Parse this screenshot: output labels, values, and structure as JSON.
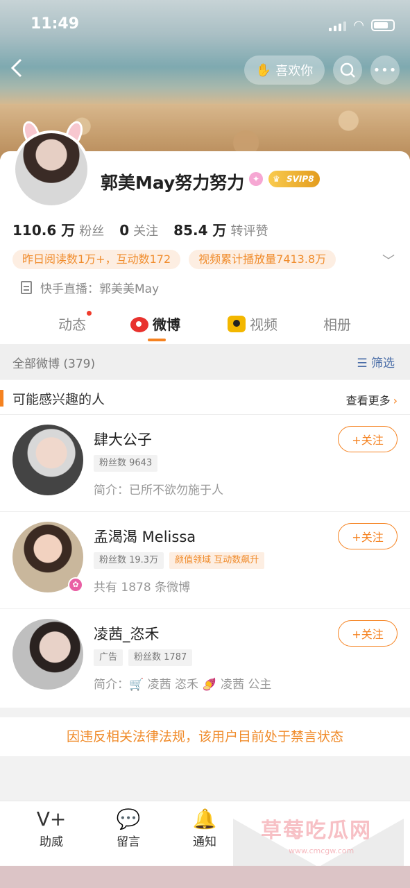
{
  "status": {
    "time": "11:49"
  },
  "header": {
    "likes_label": "喜欢你"
  },
  "profile": {
    "name": "郭美May努力努力",
    "vip_badge": "SVIP8",
    "followers_value": "110.6 万",
    "followers_label": "粉丝",
    "following_value": "0",
    "following_label": "关注",
    "interactions_value": "85.4 万",
    "interactions_label": "转评赞",
    "chips": [
      "昨日阅读数1万+，互动数172",
      "视频累计播放量7413.8万"
    ],
    "live_text": "快手直播：郭美美May"
  },
  "tabs": [
    {
      "label": "动态"
    },
    {
      "label": "微博"
    },
    {
      "label": "视频"
    },
    {
      "label": "相册"
    }
  ],
  "filter": {
    "all_label": "全部微博 (379)",
    "filter_label": "筛选"
  },
  "recommend": {
    "title": "可能感兴趣的人",
    "more_label": "查看更多",
    "users": [
      {
        "name": "肆大公子",
        "tags": [
          "粉丝数 9643"
        ],
        "desc": "简介：已所不欲勿施于人",
        "follow": "+关注"
      },
      {
        "name": "孟渴渴 Melissa",
        "tags": [
          "粉丝数 19.3万",
          "颜值领域 互动数飙升"
        ],
        "desc": "共有 1878 条微博",
        "follow": "+关注"
      },
      {
        "name": "凌茜_恣禾",
        "tags": [
          "广告",
          "粉丝数 1787"
        ],
        "desc_prefix": "简介：",
        "desc_a": "凌茜 恣禾",
        "desc_b": "凌茜 公主",
        "follow": "+关注"
      }
    ]
  },
  "warning": "因违反相关法律法规，该用户目前处于禁言状态",
  "bottom_bar": [
    {
      "label": "助威"
    },
    {
      "label": "留言"
    },
    {
      "label": "通知"
    }
  ],
  "watermark": {
    "text": "草莓吃瓜网",
    "url": "www.cmcgw.com"
  }
}
